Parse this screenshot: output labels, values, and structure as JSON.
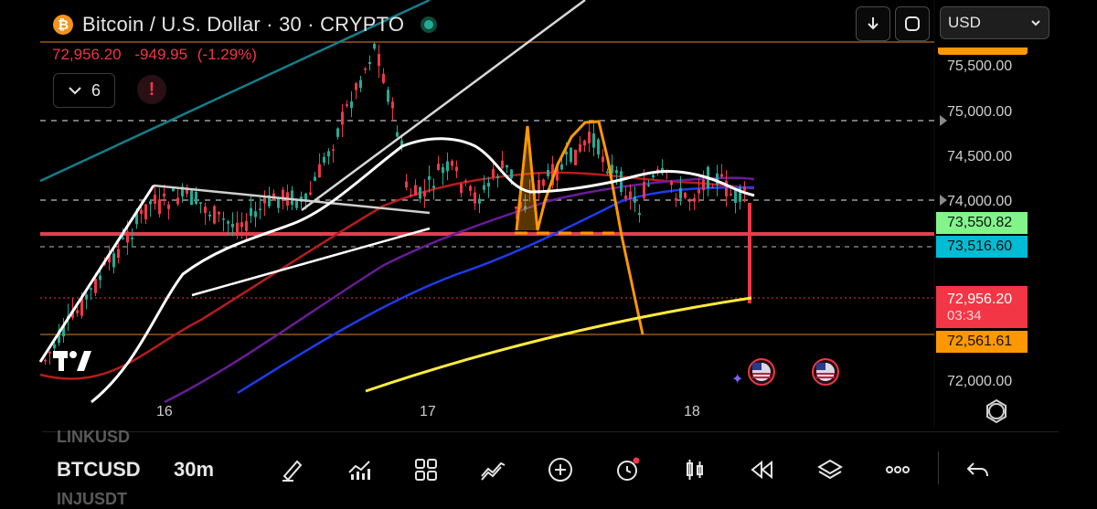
{
  "header": {
    "title": "Bitcoin / U.S. Dollar · 30 · CRYPTO",
    "coin_glyph": "₿",
    "last_price": "72,956.20",
    "change": "-949.95",
    "change_pct": "(-1.29%)",
    "indicator_count": "6",
    "alert_glyph": "!"
  },
  "toolbar": {
    "currency": "USD"
  },
  "price_scale": {
    "labels": [
      "75,500.00",
      "75,000.00",
      "74,500.00",
      "74,000.00",
      "72,000.00"
    ],
    "tag_green": "73,550.82",
    "tag_cyan": "73,516.60",
    "tag_last": "72,956.20",
    "tag_countdown": "03:34",
    "tag_orange": "72,561.61"
  },
  "time_scale": {
    "labels": [
      "16",
      "17",
      "18"
    ]
  },
  "bottom_bar": {
    "ghost_above": "LINKUSD",
    "symbol": "BTCUSD",
    "interval": "30m",
    "ghost_below": "INJUSDT"
  },
  "colors": {
    "up": "#22ab94",
    "down": "#f23645",
    "orange": "#ff9800",
    "yellow": "#ffeb3b",
    "cyan": "#00bcd4",
    "green_tag": "#81f58a"
  },
  "icons": [
    "bitcoin-icon",
    "live-status-icon",
    "chevron-down-icon",
    "alert-icon",
    "download-icon",
    "fullscreen-icon",
    "settings-icon",
    "pencil-icon",
    "indicators-icon",
    "grid-icon",
    "trend-icon",
    "plus-icon",
    "alarm-icon",
    "candles-icon",
    "rewind-icon",
    "layers-icon",
    "more-icon",
    "undo-icon"
  ]
}
